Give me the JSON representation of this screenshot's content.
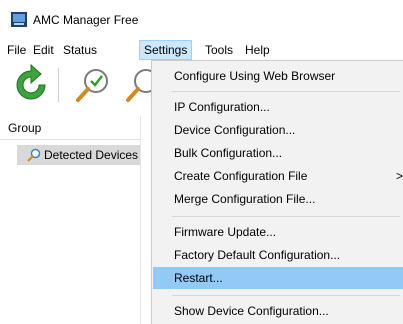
{
  "window": {
    "title": "AMC Manager Free",
    "icon": "amc-app-icon"
  },
  "menubar": {
    "items": [
      {
        "label": "File"
      },
      {
        "label": "Edit"
      },
      {
        "label": "Status"
      },
      {
        "label": "Settings"
      },
      {
        "label": "Tools"
      },
      {
        "label": "Help"
      }
    ],
    "active": "Settings"
  },
  "toolbar": {
    "buttons": [
      {
        "icon": "refresh-icon"
      },
      {
        "icon": "search-check-icon"
      },
      {
        "icon": "search-icon"
      }
    ]
  },
  "left_pane": {
    "header": "Group",
    "tree_items": [
      {
        "label": "Detected Devices",
        "icon": "search-icon"
      }
    ]
  },
  "settings_menu": {
    "items": [
      {
        "label": "Configure Using Web Browser"
      },
      {
        "label": "IP Configuration..."
      },
      {
        "label": "Device Configuration..."
      },
      {
        "label": "Bulk Configuration..."
      },
      {
        "label": "Create Configuration File",
        "submenu_arrow": ">"
      },
      {
        "label": "Merge Configuration File..."
      },
      {
        "label": "Firmware Update..."
      },
      {
        "label": "Factory Default Configuration..."
      },
      {
        "label": "Restart..."
      },
      {
        "label": "Show Device Configuration..."
      }
    ],
    "highlighted": "Restart...",
    "highlight_color": "#91c9f7"
  },
  "colors": {
    "menu_active_bg": "#cce8ff",
    "menu_bg": "#f2f2f2",
    "tree_selected_bg": "#d9d9d9",
    "refresh_green": "#3aa53a"
  }
}
